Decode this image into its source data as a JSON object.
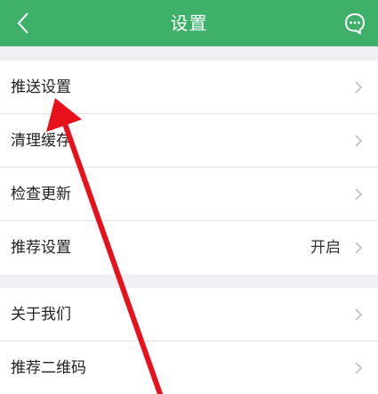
{
  "header": {
    "title": "设置",
    "accent_color": "#3fb06a",
    "back_icon": "chevron-left-icon",
    "right_icon": "message-bubble-icon"
  },
  "groups": [
    {
      "items": [
        {
          "label": "推送设置",
          "value": ""
        },
        {
          "label": "清理缓存",
          "value": ""
        },
        {
          "label": "检查更新",
          "value": ""
        },
        {
          "label": "推荐设置",
          "value": "开启"
        }
      ]
    },
    {
      "items": [
        {
          "label": "关于我们",
          "value": ""
        },
        {
          "label": "推荐二维码",
          "value": ""
        }
      ]
    }
  ],
  "annotation": {
    "arrow_color": "#e8101a"
  }
}
